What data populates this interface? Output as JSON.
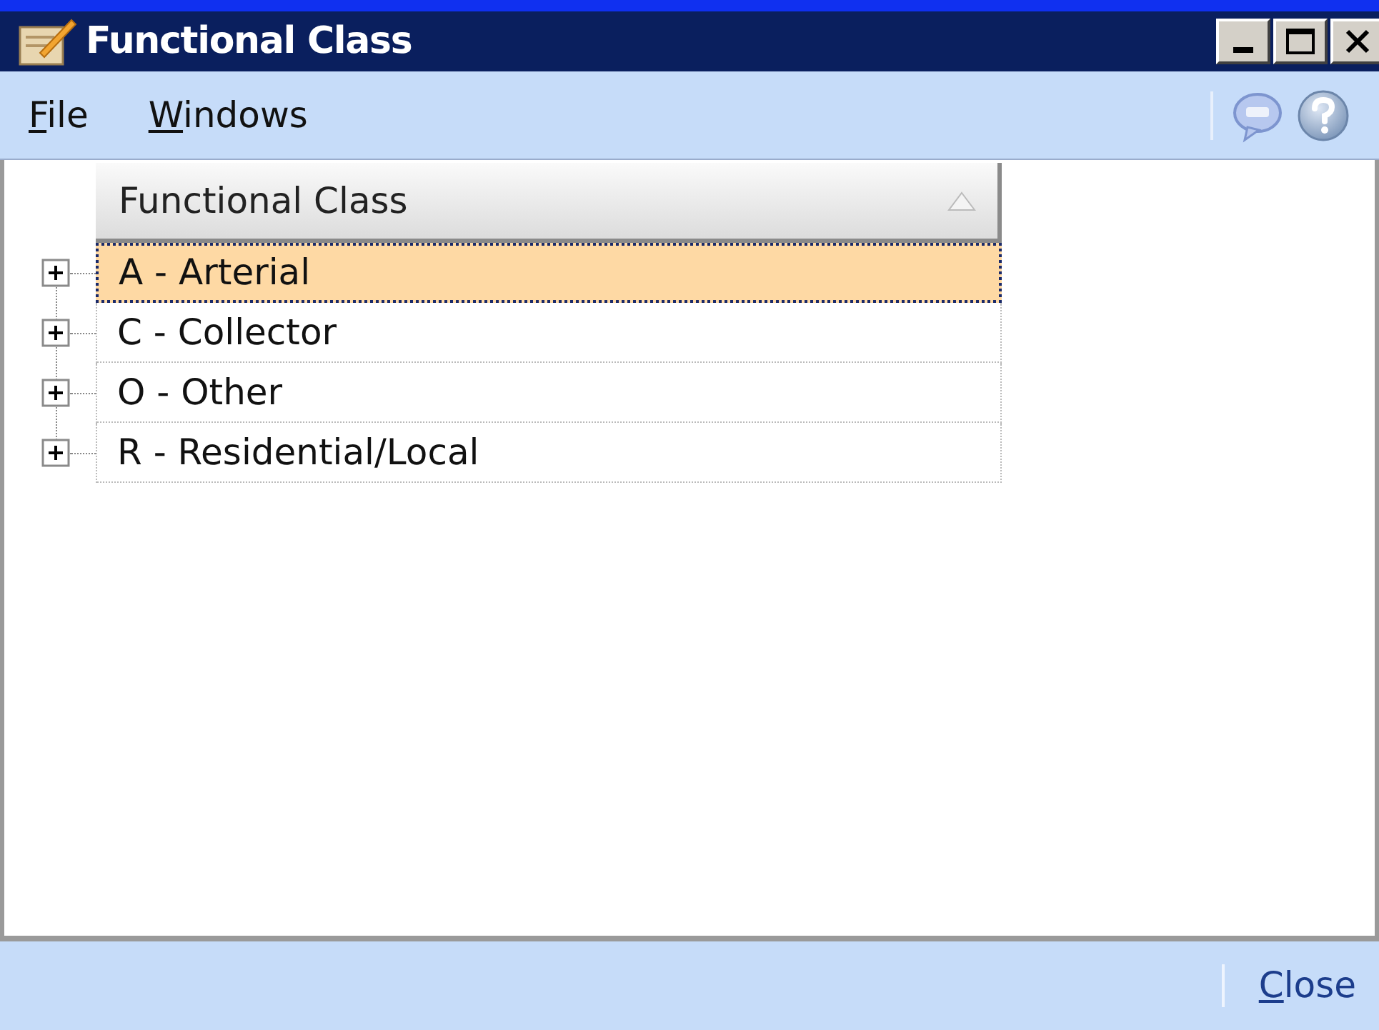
{
  "window": {
    "title": "Functional Class"
  },
  "menu": [
    {
      "label": "File"
    },
    {
      "label": "Windows"
    }
  ],
  "grid": {
    "column": "Functional Class",
    "rows": [
      {
        "label": "A - Arterial",
        "selected": true,
        "expanded": false
      },
      {
        "label": "C - Collector",
        "selected": false,
        "expanded": false
      },
      {
        "label": "O - Other",
        "selected": false,
        "expanded": false
      },
      {
        "label": "R - Residential/Local",
        "selected": false,
        "expanded": false
      }
    ]
  },
  "footer": {
    "close": "Close"
  }
}
